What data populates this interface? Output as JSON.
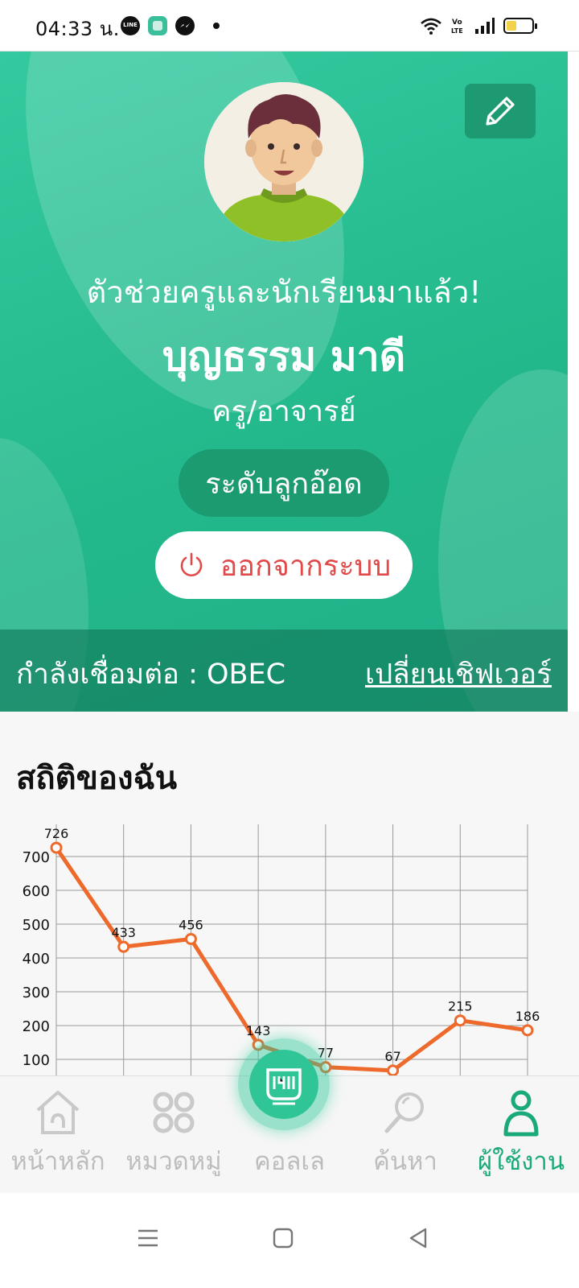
{
  "status_bar": {
    "time": "04:33 น.",
    "icons": [
      "line-app-icon",
      "app-icon",
      "messenger-icon",
      "wifi-icon",
      "volte-icon",
      "signal-icon",
      "battery-icon"
    ],
    "volte_label": "Vo LTE",
    "battery_level": 0.3
  },
  "profile": {
    "tagline": "ตัวช่วยครูและนักเรียนมาแล้ว!",
    "name": "บุญธรรม มาดี",
    "role": "ครู/อาจารย์",
    "level": "ระดับลูกอ๊อด",
    "logout_label": "ออกจากระบบ",
    "connection_label": "กำลังเชื่อมต่อ : OBEC",
    "change_server_label": "เปลี่ยนเชิฟเวอร์",
    "colors": {
      "header": "#23b98c",
      "badge": "#1c9a70",
      "logout_text": "#e24a4a"
    }
  },
  "stats": {
    "title": "สถิติของฉัน"
  },
  "chart_data": {
    "type": "line",
    "x": [
      0,
      1,
      2,
      3,
      4,
      5,
      6,
      7
    ],
    "values": [
      726,
      433,
      456,
      143,
      77,
      67,
      215,
      186
    ],
    "data_labels": [
      "726",
      "433",
      "456",
      "143",
      "77",
      "67",
      "215",
      "186"
    ],
    "y_ticks": [
      100,
      200,
      300,
      400,
      500,
      600,
      700
    ],
    "y_tick_labels": [
      "100",
      "200",
      "300",
      "400",
      "500",
      "600",
      "700"
    ],
    "ylim": [
      50,
      760
    ],
    "grid": true,
    "line_color": "#ee6a2c"
  },
  "bottom_nav": {
    "items": [
      {
        "label": "หน้าหลัก",
        "icon": "home-icon"
      },
      {
        "label": "หมวดหมู่",
        "icon": "category-icon"
      },
      {
        "label": "คอลเล",
        "icon": "collection-icon"
      },
      {
        "label": "ค้นหา",
        "icon": "search-icon"
      },
      {
        "label": "ผู้ใช้งาน",
        "icon": "user-icon"
      }
    ],
    "active_index": 4,
    "active_color": "#1aa97a"
  },
  "system_nav": {
    "icons": [
      "menu-icon",
      "home-square-icon",
      "back-icon"
    ]
  }
}
